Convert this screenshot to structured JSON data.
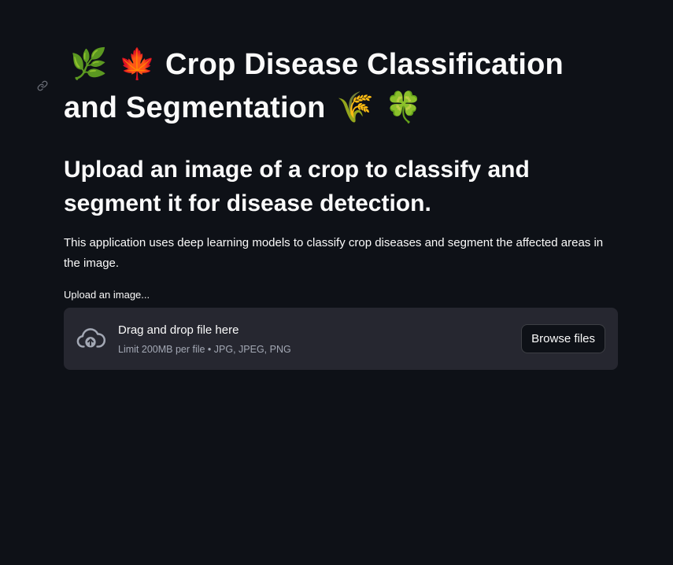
{
  "title": {
    "emoji_left_1": "🌿",
    "emoji_left_2": "🍁",
    "text": "Crop Disease Classification and Segmentation",
    "emoji_right_1": "🌾",
    "emoji_right_2": "🍀"
  },
  "subtitle": "Upload an image of a crop to classify and segment it for disease detection.",
  "description": "This application uses deep learning models to classify crop diseases and segment the affected areas in the image.",
  "uploader": {
    "label": "Upload an image...",
    "drop_text": "Drag and drop file here",
    "limit_text": "Limit 200MB per file • JPG, JPEG, PNG",
    "browse_label": "Browse files",
    "icon": "cloud-upload-icon"
  },
  "colors": {
    "background": "#0e1117",
    "dropzone": "#262730",
    "text": "#fafafa",
    "muted": "#a3a8b4"
  }
}
